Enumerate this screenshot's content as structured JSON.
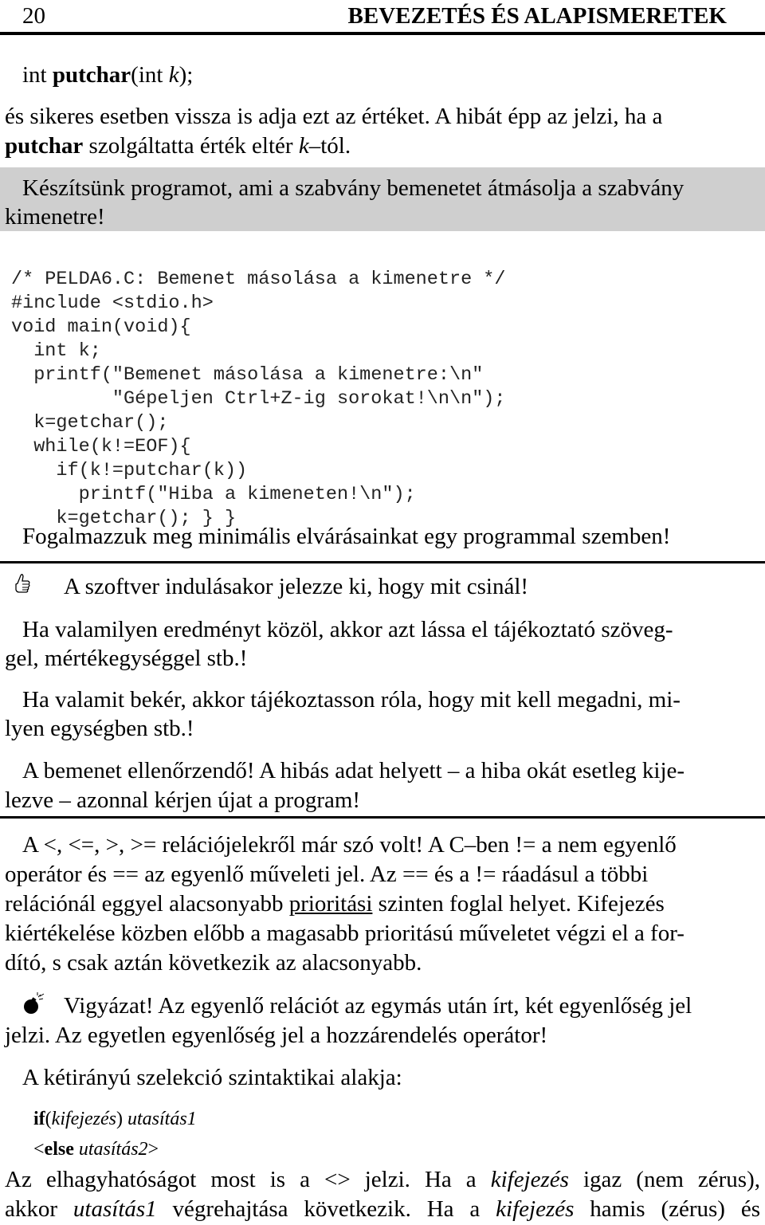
{
  "header": {
    "page_number": "20",
    "running_title": "BEVEZETÉS ÉS ALAPISMERETEK"
  },
  "prototype": {
    "ret": "int ",
    "fn": "putchar",
    "open": "(int ",
    "param": "k",
    "close": ");"
  },
  "para1": {
    "line1": "és sikeres esetben vissza is adja ezt az értéket. A hibát épp az jelzi, ha a",
    "line2_bold": "putchar",
    "line2_rest": " szolgáltatta érték eltér ",
    "line2_italic": "k",
    "line2_end": "–tól."
  },
  "task_box": {
    "line1": "Készítsünk programot, ami a szabvány bemenetet átmásolja a szabvány",
    "line2": "kimenetre!"
  },
  "code": [
    "/* PELDA6.C: Bemenet másolása a kimenetre */",
    "#include <stdio.h>",
    "void main(void){",
    "  int k;",
    "  printf(\"Bemenet másolása a kimenetre:\\n\"",
    "         \"Gépeljen Ctrl+Z-ig sorokat!\\n\\n\");",
    "  k=getchar();",
    "  while(k!=EOF){",
    "    if(k!=putchar(k))",
    "      printf(\"Hiba a kimeneten!\\n\");",
    "    k=getchar(); } }"
  ],
  "requirements_intro": "Fogalmazzuk meg minimális elvárásainkat egy programmal szemben!",
  "requirements": {
    "icon": "thumbs-up-icon",
    "item1": "A szoftver indulásakor jelezze ki, hogy mit csinál!",
    "item2_line1": "Ha valamilyen eredményt közöl, akkor azt lássa el tájékoztató szöveg-",
    "item2_line2": "gel, mértékegységgel stb.!",
    "item3_line1": "Ha valamit bekér, akkor tájékoztasson róla, hogy mit kell megadni, mi-",
    "item3_line2": "lyen egységben stb.!",
    "item4_line1": "A bemenet ellenőrzendő! A hibás adat helyett – a hiba okát esetleg kije-",
    "item4_line2": "lezve – azonnal kérjen újat a program!"
  },
  "relations": {
    "line1": "A <, <=, >, >= relációjelekről már szó volt! A C–ben != a nem egyenlő",
    "line2": "operátor és == az egyenlő műveleti jel. Az == és a != ráadásul a többi",
    "line3_a": "relációnál eggyel alacsonyabb ",
    "line3_u": "prioritási",
    "line3_b": " szinten foglal helyet. Kifejezés",
    "line4": "kiértékelése közben előbb a magasabb prioritású műveletet végzi el a for-",
    "line5": "dító, s csak aztán következik az alacsonyabb."
  },
  "warning": {
    "icon": "bomb-icon",
    "line1": "Vigyázat! Az egyenlő relációt az egymás után írt, két egyenlőség jel",
    "line2": "jelzi. Az egyetlen egyenlőség jel a hozzárendelés operátor!"
  },
  "syntax_intro": "A kétirányú szelekció szintaktikai alakja:",
  "syntax": {
    "if_kw": "if",
    "open": "(",
    "expr": "kifejezés",
    "close": ") ",
    "stmt1": "utasítás1",
    "lt": "<",
    "else_kw": "else",
    "stmt2": " utasítás2",
    "gt": ">"
  },
  "final": {
    "l1_a": "Az elhagyhatóságot most is a <> jelzi. Ha a ",
    "l1_i": "kifejezés",
    "l1_b": " igaz (nem zérus),",
    "l2_a": "akkor ",
    "l2_i1": "utasítás1",
    "l2_b": " végrehajtása következik. Ha a ",
    "l2_i2": "kifejezés",
    "l2_c": " hamis (zérus) és"
  }
}
